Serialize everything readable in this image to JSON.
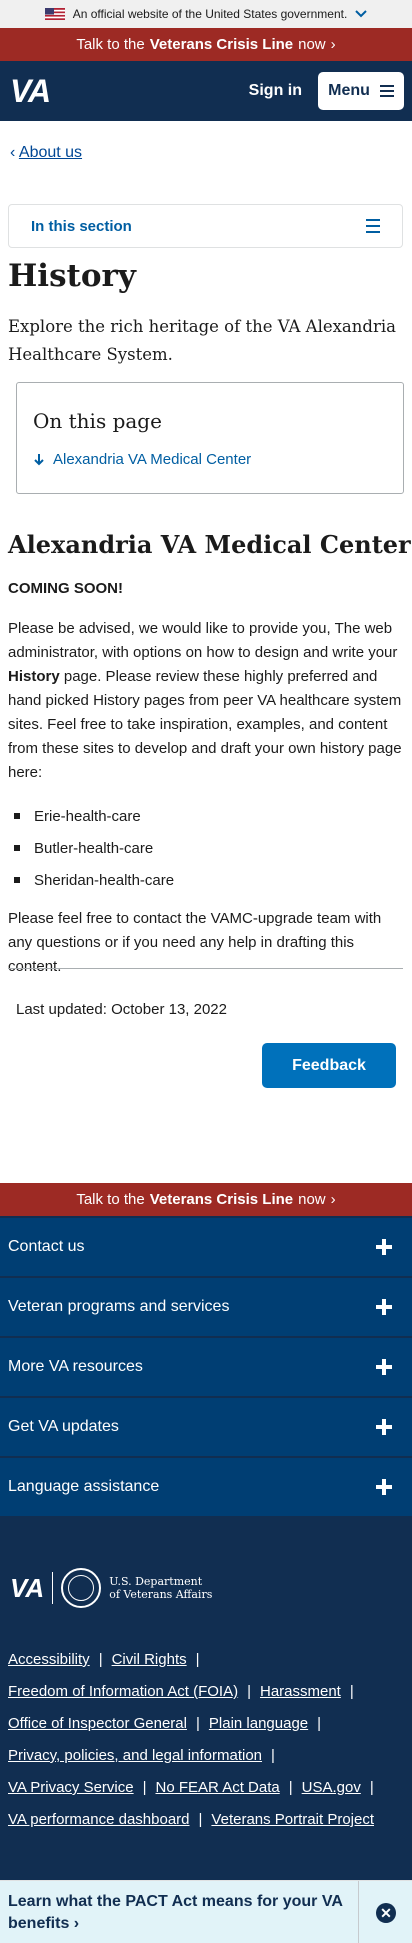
{
  "gov_banner": {
    "text": "An official website of the United States government."
  },
  "crisis": {
    "prefix": "Talk to the",
    "bold": "Veterans Crisis Line",
    "suffix": "now",
    "arrow": "›"
  },
  "header": {
    "logo": "VA",
    "sign_in": "Sign in",
    "menu": "Menu"
  },
  "breadcrumb": {
    "arrow": "‹",
    "label": "About us"
  },
  "section_nav": {
    "label": "In this section"
  },
  "page": {
    "title": "History",
    "intro": "Explore the rich heritage of the VA Alexandria Healthcare System."
  },
  "on_this_page": {
    "heading": "On this page",
    "link": "Alexandria VA Medical Center"
  },
  "content": {
    "heading": "Alexandria VA Medical Center",
    "coming_soon": "COMING SOON!",
    "para1_a": "Please be advised, we would like to provide you, The web administrator, with options on how to design and write your ",
    "para1_bold": "History",
    "para1_b": " page. Please review these highly preferred and hand picked History pages from peer VA healthcare system sites.  Feel free to take inspiration, examples, and content from these sites to develop and draft your own history page here:",
    "links": [
      "Erie-health-care",
      "Butler-health-care",
      "Sheridan-health-care"
    ],
    "para2": "Please feel free to contact the VAMC-upgrade team with any questions or if you need any help in drafting this content.",
    "last_updated": "Last updated: October 13, 2022",
    "feedback": "Feedback"
  },
  "footer": {
    "accordions": [
      "Contact us",
      "Veteran programs and services",
      "More VA resources",
      "Get VA updates",
      "Language assistance"
    ],
    "logo": "VA",
    "dept_line1": "U.S. Department",
    "dept_line2": "of Veterans Affairs",
    "links": [
      "Accessibility",
      "Civil Rights",
      "Freedom of Information Act (FOIA)",
      "Harassment",
      "Office of Inspector General",
      "Plain language",
      "Privacy, policies, and legal information",
      "VA Privacy Service",
      "No FEAR Act Data",
      "USA.gov",
      "VA performance dashboard",
      "Veterans Portrait Project"
    ],
    "pipe": "|"
  },
  "pact": {
    "text": "Learn what the PACT Act means for your VA benefits",
    "arrow": "›",
    "close": "✕"
  },
  "colors": {
    "navy": "#112e51",
    "crisis_red": "#9d2a24",
    "link_blue": "#005ea2",
    "button_blue": "#0071bb"
  }
}
